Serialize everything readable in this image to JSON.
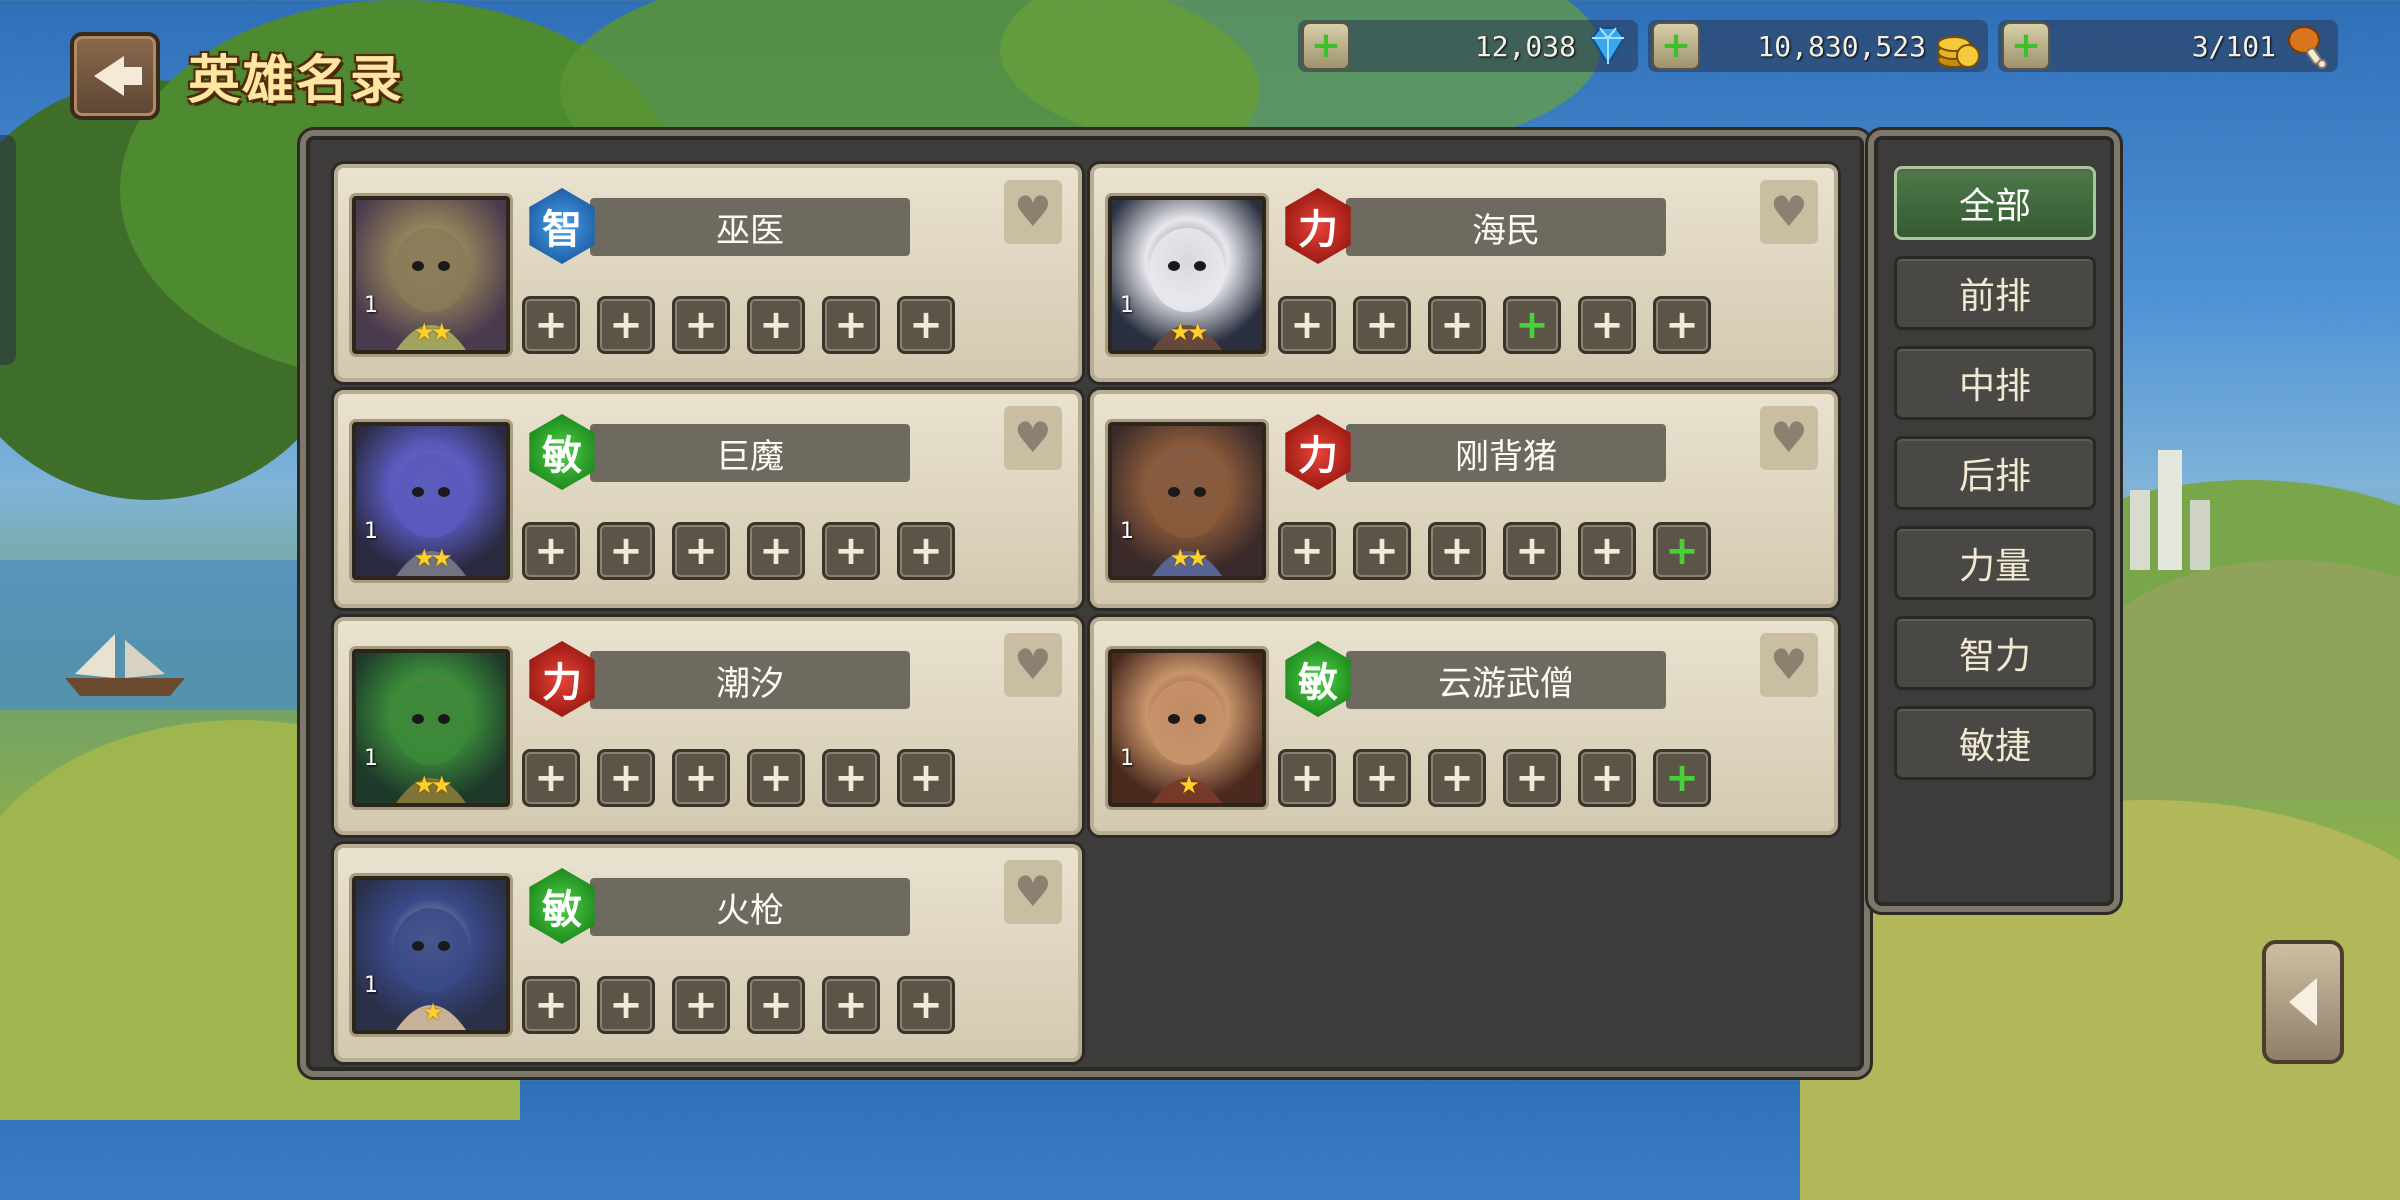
{
  "header": {
    "title": "英雄名录"
  },
  "currencies": [
    {
      "name": "gems",
      "value": "12,038",
      "icon": "diamond-icon"
    },
    {
      "name": "gold",
      "value": "10,830,523",
      "icon": "gold-coins-icon"
    },
    {
      "name": "stamina",
      "value": "3/101",
      "icon": "drumstick-icon"
    }
  ],
  "filters": [
    {
      "label": "全部",
      "active": true
    },
    {
      "label": "前排"
    },
    {
      "label": "中排"
    },
    {
      "label": "后排"
    },
    {
      "label": "力量"
    },
    {
      "label": "智力"
    },
    {
      "label": "敏捷"
    }
  ],
  "heroes": [
    {
      "name": "巫医",
      "attr": "智",
      "attr_type": "int",
      "level": "1",
      "stars": "★★",
      "green_slots": []
    },
    {
      "name": "海民",
      "attr": "力",
      "attr_type": "str",
      "level": "1",
      "stars": "★★",
      "green_slots": [
        3
      ]
    },
    {
      "name": "巨魔",
      "attr": "敏",
      "attr_type": "agi",
      "level": "1",
      "stars": "★★",
      "green_slots": []
    },
    {
      "name": "刚背猪",
      "attr": "力",
      "attr_type": "str",
      "level": "1",
      "stars": "★★",
      "green_slots": [
        5
      ]
    },
    {
      "name": "潮汐",
      "attr": "力",
      "attr_type": "str",
      "level": "1",
      "stars": "★★",
      "green_slots": []
    },
    {
      "name": "云游武僧",
      "attr": "敏",
      "attr_type": "agi",
      "level": "1",
      "stars": "★",
      "green_slots": [
        5
      ]
    },
    {
      "name": "火枪",
      "attr": "敏",
      "attr_type": "agi",
      "level": "1",
      "stars": "★",
      "green_slots": []
    }
  ],
  "slot_symbol": "+",
  "colors": {
    "panel": "#3d3c3a",
    "card": "#e9e2cf",
    "accent_green": "#48d03a",
    "gold_text": "#ffe6a3"
  }
}
